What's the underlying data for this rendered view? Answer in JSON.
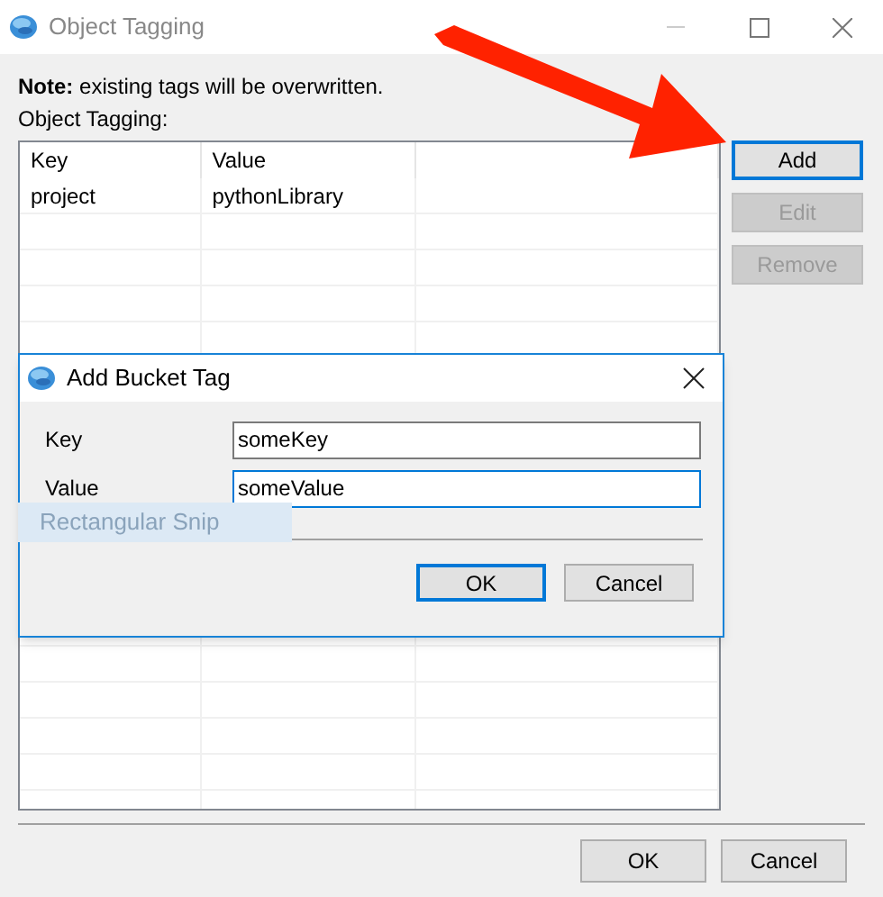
{
  "window": {
    "title": "Object Tagging"
  },
  "note": {
    "label": "Note:",
    "text": "existing tags will be overwritten."
  },
  "table_label": "Object Tagging:",
  "table": {
    "columns": [
      "Key",
      "Value"
    ],
    "rows": [
      {
        "key": "project",
        "value": "pythonLibrary"
      }
    ]
  },
  "side_buttons": [
    {
      "label": "Add",
      "disabled": false,
      "focused": true
    },
    {
      "label": "Edit",
      "disabled": true,
      "focused": false
    },
    {
      "label": "Remove",
      "disabled": true,
      "focused": false
    }
  ],
  "buttons": [
    {
      "label": "OK"
    },
    {
      "label": "Cancel"
    }
  ],
  "dialog": {
    "title": "Add Bucket Tag",
    "fields": [
      {
        "label": "Key",
        "value": "someKey",
        "focused": false
      },
      {
        "label": "Value",
        "value": "someValue",
        "focused": true
      }
    ],
    "buttons": [
      {
        "label": "OK",
        "focused": true
      },
      {
        "label": "Cancel",
        "focused": false
      }
    ]
  },
  "snip_overlay": "Rectangular Snip"
}
